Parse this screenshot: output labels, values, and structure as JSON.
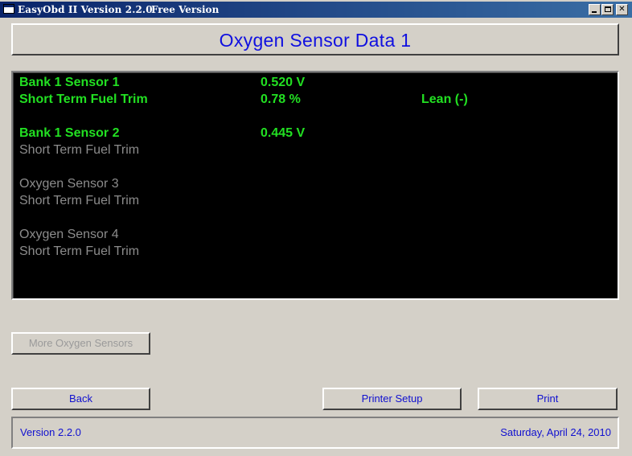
{
  "window": {
    "title": "EasyObd II Version 2.2.0",
    "edition": "Free Version",
    "controls": {
      "minimize": "_",
      "maximize": "□",
      "close": "✕"
    }
  },
  "header": {
    "title": "Oxygen Sensor Data 1"
  },
  "sensors": [
    {
      "name": "Bank 1 Sensor 1",
      "voltage": "0.520 V",
      "trim_label": "Short Term Fuel Trim",
      "trim_value": "0.78 %",
      "status": "Lean (-)",
      "active": true,
      "trim_active": true
    },
    {
      "name": "Bank 1 Sensor 2",
      "voltage": "0.445 V",
      "trim_label": "Short Term Fuel Trim",
      "trim_value": "",
      "status": "",
      "active": true,
      "trim_active": false
    },
    {
      "name": "Oxygen Sensor 3",
      "voltage": "",
      "trim_label": "Short Term Fuel Trim",
      "trim_value": "",
      "status": "",
      "active": false,
      "trim_active": false
    },
    {
      "name": "Oxygen Sensor 4",
      "voltage": "",
      "trim_label": "Short Term Fuel Trim",
      "trim_value": "",
      "status": "",
      "active": false,
      "trim_active": false
    }
  ],
  "buttons": {
    "more_sensors": "More Oxygen Sensors",
    "back": "Back",
    "printer_setup": "Printer Setup",
    "print": "Print"
  },
  "status_bar": {
    "version": "Version 2.2.0",
    "date": "Saturday, April 24, 2010"
  },
  "colors": {
    "active_text": "#22e022",
    "inactive_text": "#8c8c8c",
    "accent_blue": "#1010e0",
    "panel_bg": "#000000"
  }
}
